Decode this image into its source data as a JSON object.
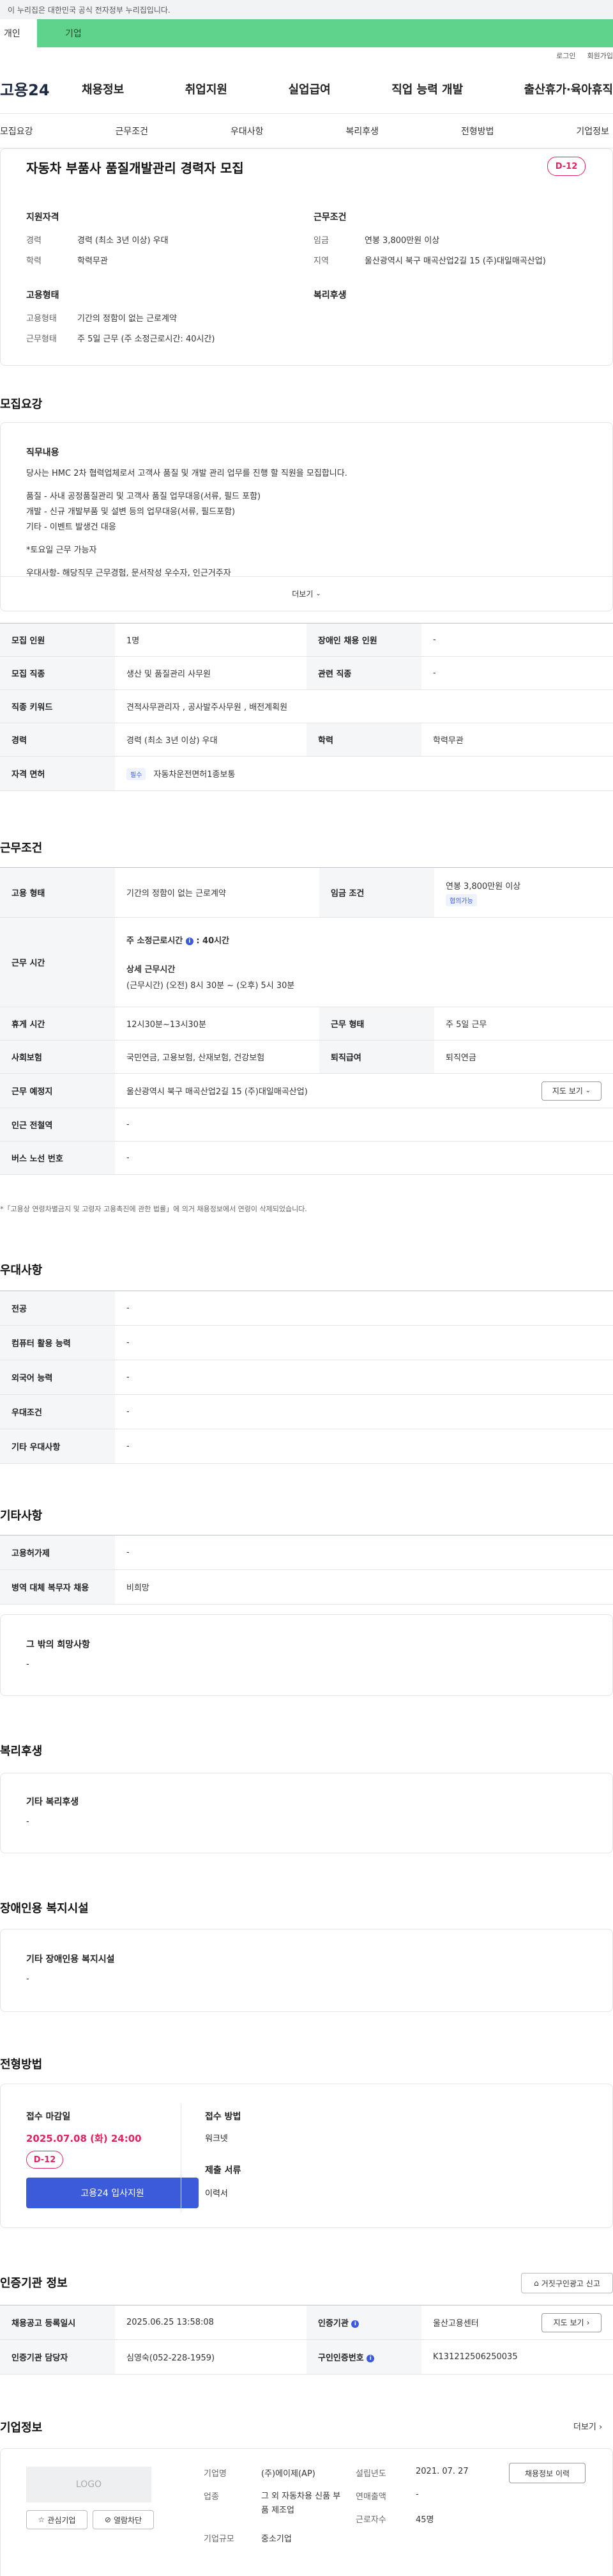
{
  "gov_banner": {
    "text": "이 누리집은 대한민국 공식 전자정부 누리집입니다."
  },
  "brand_tabs": {
    "individual": "개인",
    "corporate": "기업"
  },
  "utility": {
    "login": "로그인",
    "signup": "회원가입"
  },
  "logo": "고용24",
  "main_nav": [
    "채용정보",
    "취업지원",
    "실업급여",
    "직업 능력 개발",
    "출산휴가·육아휴직"
  ],
  "sub_nav": [
    "모집요강",
    "근무조건",
    "우대사항",
    "복리후생",
    "전형방법",
    "기업정보"
  ],
  "job": {
    "title": "자동차 부품사 품질개발관리 경력자 모집",
    "dday": "D-12",
    "qualification_title": "지원자격",
    "qualification": [
      {
        "label": "경력",
        "value": "경력 (최소 3년 이상) 우대"
      },
      {
        "label": "학력",
        "value": "학력무관"
      }
    ],
    "conditions_title": "근무조건",
    "conditions": [
      {
        "label": "임금",
        "value": "연봉 3,800만원 이상"
      },
      {
        "label": "지역",
        "value": "울산광역시 북구 매곡산업2길 15 (주)대일매곡산업)"
      }
    ],
    "employment_title": "고용형태",
    "employment": [
      {
        "label": "고용형태",
        "value": "기간의 정함이 없는 근로계약"
      },
      {
        "label": "근무형태",
        "value": "주 5일 근무 (주 소정근로시간: 40시간)"
      }
    ],
    "welfare_title": "복리후생"
  },
  "recruit": {
    "section_title": "모집요강",
    "duty_title": "직무내용",
    "duty_lines": [
      "당사는 HMC 2차 협력업체로서 고객사 품질 및 개발 관리 업무를 진행 할 직원을 모집합니다.",
      "",
      "품질 - 사내 공정품질관리 및 고객사 품질 업무대응(서류, 필드 포함)",
      "개발 - 신규 개발부품 및 설변 등의 업무대응(서류, 필드포함)",
      "기타 - 이벤트 발생건 대응",
      "",
      "*토요일 근무 가능자",
      "",
      "우대사항- 해당직무 근무경험, 문서작성 우수자, 인근거주자"
    ],
    "more": "더보기",
    "table": [
      {
        "h1": "모집 인원",
        "v1": "1명",
        "h2": "장애인 채용 인원",
        "v2": "-"
      },
      {
        "h1": "모집 직종",
        "v1": "생산 및 품질관리 사무원",
        "h2": "관련 직종",
        "v2": "-"
      },
      {
        "h1": "직종 키워드",
        "v1": "견적사무관리자 , 공사발주사무원 , 배전계획원",
        "h2": "",
        "v2": ""
      },
      {
        "h1": "경력",
        "v1": "경력 (최소 3년 이상) 우대",
        "h2": "학력",
        "v2": "학력무관"
      },
      {
        "h1": "자격 면허",
        "v1": "자동차운전면허1종보통",
        "h2": "",
        "v2": ""
      }
    ],
    "license_chip": "필수"
  },
  "work": {
    "section_title": "근무조건",
    "employment_h": "고용 형태",
    "employment_v": "기간의 정함이 없는 근로계약",
    "wage_h": "임금 조건",
    "wage_v": "연봉 3,800만원 이상",
    "wage_chip": "협의가능",
    "hours_h": "근무 시간",
    "hours_weekly_label": "주 소정근로시간",
    "hours_weekly_value": ": 40시간",
    "hours_detail_title": "상세 근무시간",
    "hours_detail": "(근무시간) (오전) 8시 30분 ~ (오후) 5시 30분",
    "break_h": "휴게 시간",
    "break_v": "12시30분~13시30분",
    "type_h": "근무 형태",
    "type_v": "주 5일 근무",
    "insurance_h": "사회보험",
    "insurance_v": "국민연금, 고용보험, 산재보험, 건강보험",
    "retire_h": "퇴직급여",
    "retire_v": "퇴직연금",
    "location_h": "근무 예정지",
    "location_v": "울산광역시 북구 매곡산업2길 15 (주)대일매곡산업)",
    "map_btn": "지도 보기",
    "subway_h": "인근 전철역",
    "subway_v": "-",
    "bus_h": "버스 노선 번호",
    "bus_v": "-",
    "note": "*「고용상 연령차별금지 및 고령자 고용촉진에 관한 법률」에 의거 채용정보에서 연령이 삭제되었습니다."
  },
  "preference": {
    "section_title": "우대사항",
    "rows": [
      {
        "h": "전공",
        "v": "-"
      },
      {
        "h": "컴퓨터 활용 능력",
        "v": "-"
      },
      {
        "h": "외국어 능력",
        "v": "-"
      },
      {
        "h": "우대조건",
        "v": "-"
      },
      {
        "h": "기타 우대사항",
        "v": "-"
      }
    ]
  },
  "etc": {
    "section_title": "기타사항",
    "rows": [
      {
        "h": "고용허가제",
        "v": "-"
      },
      {
        "h": "병역 대체 복무자 채용",
        "v": "비희망"
      }
    ],
    "other_title": "그 밖의 희망사항",
    "other_value": "-"
  },
  "welfare": {
    "section_title": "복리후생",
    "box_title": "기타 복리후생",
    "box_value": "-"
  },
  "disabled": {
    "section_title": "장애인용 복지시설",
    "box_title": "기타 장애인용 복지시설",
    "box_value": "-"
  },
  "process": {
    "section_title": "전형방법",
    "deadline_label": "접수 마감일",
    "deadline_value": "2025.07.08 (화) 24:00",
    "dday": "D-12",
    "apply_btn": "고용24 입사지원",
    "method_label": "접수 방법",
    "method_value": "워크넷",
    "docs_label": "제출 서류",
    "docs_value": "이력서"
  },
  "agency": {
    "section_title": "인증기관 정보",
    "report_btn": "거짓구인광고 신고",
    "rows": [
      {
        "h1": "채용공고 등록일시",
        "v1": "2025.06.25 13:58:08",
        "h2": "인증기관",
        "v2": "울산고용센터"
      },
      {
        "h1": "인증기관 담당자",
        "v1": "심영숙(052-228-1959)",
        "h2": "구인인증번호",
        "v2": "K131212506250035"
      }
    ],
    "map_btn": "지도 보기"
  },
  "company": {
    "section_title": "기업정보",
    "more": "더보기",
    "logo_text": "LOGO",
    "fav_btn": "관심기업",
    "block_btn": "열람차단",
    "name_label": "기업명",
    "name_value": "(주)에이제(AP)",
    "industry_label": "업종",
    "industry_value": "그 외 자동차용 신품 부품 제조업",
    "size_label": "기업규모",
    "size_value": "중소기업",
    "founded_label": "설립년도",
    "founded_value": "2021. 07. 27",
    "sales_label": "연매출액",
    "sales_value": "-",
    "employees_label": "근로자수",
    "employees_value": "45명",
    "history_btn": "채용정보 이력"
  },
  "colors": {
    "brand_green": "#5fd38b",
    "dday_red": "#e0245e",
    "apply_blue": "#3b5bdb"
  }
}
